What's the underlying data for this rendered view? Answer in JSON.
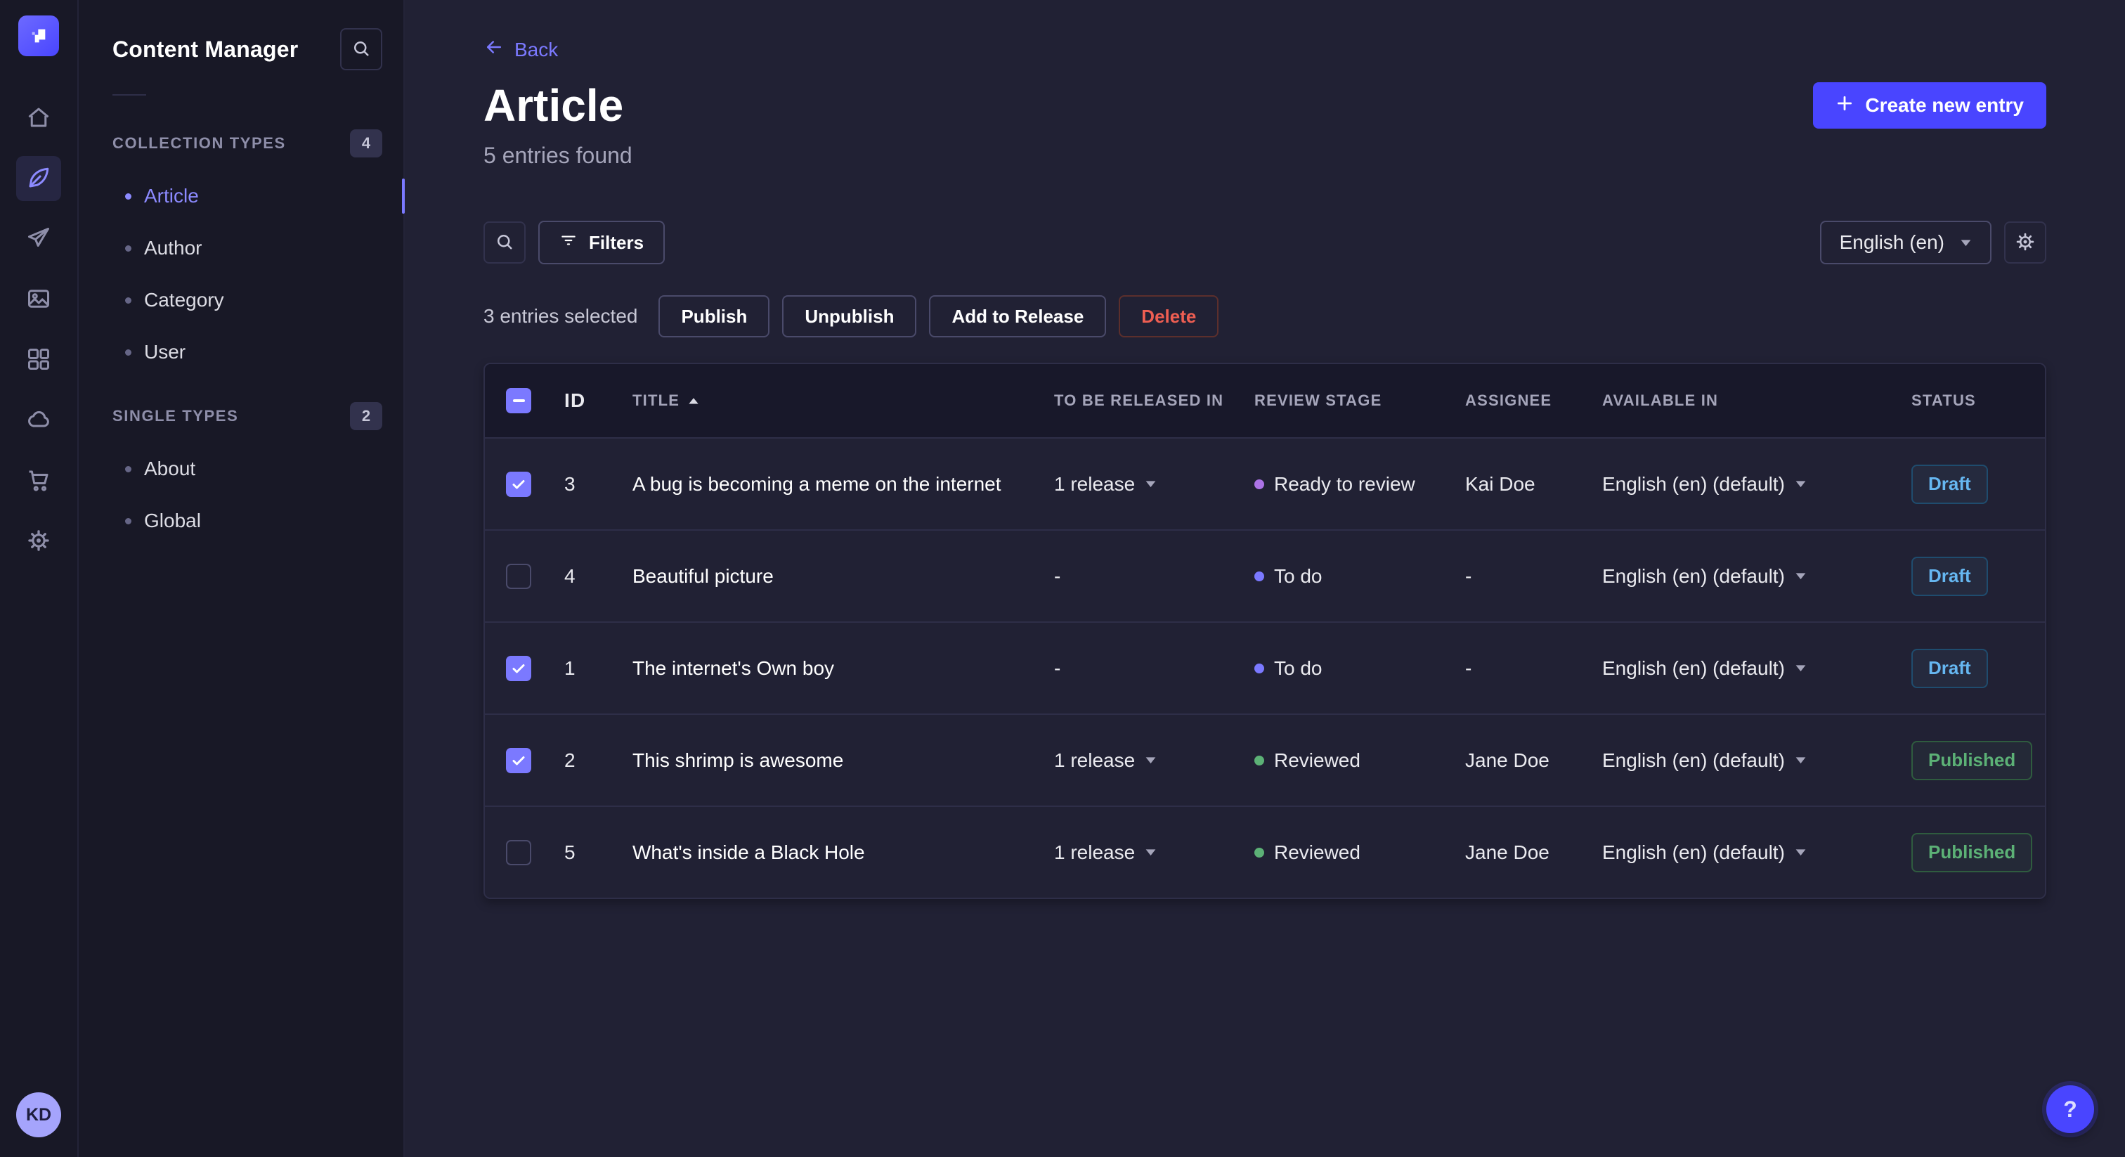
{
  "colors": {
    "primary": "#4945ff",
    "primary_light": "#7b79ff",
    "danger": "#ee5e52",
    "draft": "#66b7f1",
    "published": "#5cb176",
    "stage": {
      "purple": "#ac73e6",
      "blue": "#7b79ff",
      "green": "#5cb176"
    }
  },
  "rail": {
    "icons": [
      "strapi-logo",
      "home",
      "content-manager",
      "transfer",
      "media-library",
      "content-type-builder",
      "cloud",
      "marketplace",
      "settings"
    ],
    "avatar_initials": "KD"
  },
  "sidebar": {
    "title": "Content Manager",
    "sections": [
      {
        "label": "COLLECTION TYPES",
        "badge": "4",
        "items": [
          {
            "label": "Article",
            "active": true
          },
          {
            "label": "Author",
            "active": false
          },
          {
            "label": "Category",
            "active": false
          },
          {
            "label": "User",
            "active": false
          }
        ]
      },
      {
        "label": "SINGLE TYPES",
        "badge": "2",
        "items": [
          {
            "label": "About",
            "active": false
          },
          {
            "label": "Global",
            "active": false
          }
        ]
      }
    ]
  },
  "header": {
    "back_label": "Back",
    "title": "Article",
    "subtitle": "5 entries found",
    "create_button": "Create new entry"
  },
  "toolbar": {
    "filters_label": "Filters",
    "locale_label": "English (en)"
  },
  "selection": {
    "text": "3 entries selected",
    "actions": [
      "Publish",
      "Unpublish",
      "Add to Release",
      "Delete"
    ]
  },
  "table": {
    "header_checkbox": "indeterminate",
    "headers": [
      "ID",
      "TITLE",
      "TO BE RELEASED IN",
      "REVIEW STAGE",
      "ASSIGNEE",
      "AVAILABLE IN",
      "STATUS"
    ],
    "rows": [
      {
        "checked": true,
        "id": "3",
        "title": "A bug is becoming a meme on the internet",
        "release": "1 release",
        "release_caret": true,
        "stage": "Ready to review",
        "stage_color": "purple",
        "assignee": "Kai Doe",
        "locale": "English (en) (default)",
        "status": "Draft",
        "status_variant": "draft"
      },
      {
        "checked": false,
        "id": "4",
        "title": "Beautiful picture",
        "release": "-",
        "release_caret": false,
        "stage": "To do",
        "stage_color": "blue",
        "assignee": "-",
        "locale": "English (en) (default)",
        "status": "Draft",
        "status_variant": "draft"
      },
      {
        "checked": true,
        "id": "1",
        "title": "The internet's Own boy",
        "release": "-",
        "release_caret": false,
        "stage": "To do",
        "stage_color": "blue",
        "assignee": "-",
        "locale": "English (en) (default)",
        "status": "Draft",
        "status_variant": "draft"
      },
      {
        "checked": true,
        "id": "2",
        "title": "This shrimp is awesome",
        "release": "1 release",
        "release_caret": true,
        "stage": "Reviewed",
        "stage_color": "green",
        "assignee": "Jane Doe",
        "locale": "English (en) (default)",
        "status": "Published",
        "status_variant": "published"
      },
      {
        "checked": false,
        "id": "5",
        "title": "What's inside a Black Hole",
        "release": "1 release",
        "release_caret": true,
        "stage": "Reviewed",
        "stage_color": "green",
        "assignee": "Jane Doe",
        "locale": "English (en) (default)",
        "status": "Published",
        "status_variant": "published"
      }
    ]
  },
  "help": {
    "label": "?"
  }
}
